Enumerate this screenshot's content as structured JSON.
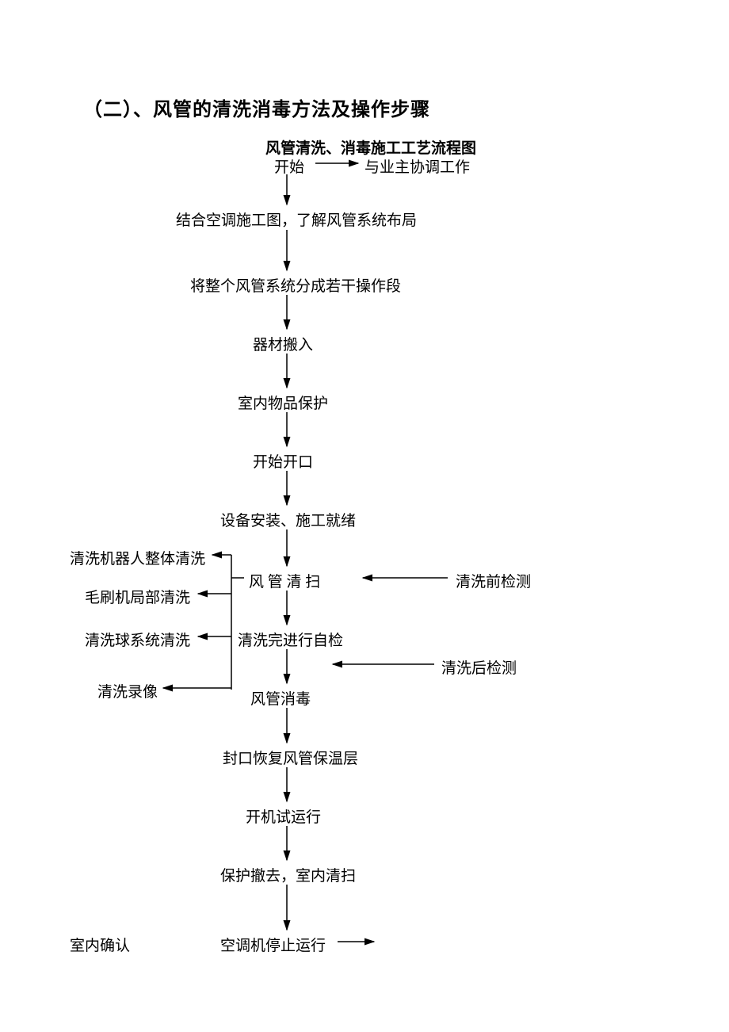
{
  "section_title": "（二）、风管的清洗消毒方法及操作步骤",
  "flow_title": "风管清洗、消毒施工工艺流程图",
  "nodes": {
    "start": "开始",
    "coord": "与业主协调工作",
    "step1": "结合空调施工图，了解风管系统布局",
    "step2": "将整个风管系统分成若干操作段",
    "step3": "器材搬入",
    "step4": "室内物品保护",
    "step5": "开始开口",
    "step6": "设备安装、施工就绪",
    "step7": "风  管 清  扫",
    "side_left1": "清洗机器人整体清洗",
    "side_left2": "毛刷机局部清洗",
    "side_left3": "清洗球系统清洗",
    "side_left4": "清洗录像",
    "side_right1": "清洗前检测",
    "step8": "清洗完进行自检",
    "side_right2": "清洗后检测",
    "step9": "风管消毒",
    "step10": "封口恢复风管保温层",
    "step11": "开机试运行",
    "step12": "保护撤去，室内清扫",
    "step13": "空调机停止运行",
    "confirm": "室内确认"
  }
}
